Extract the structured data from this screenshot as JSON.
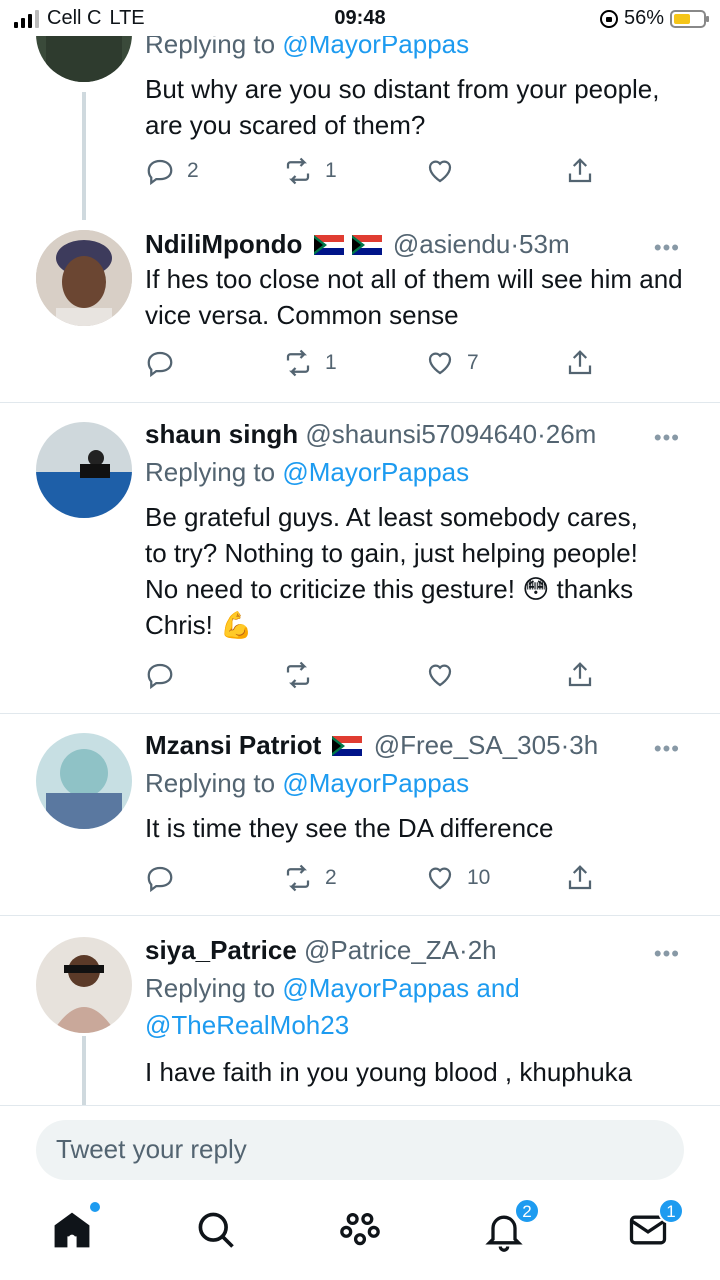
{
  "status_bar": {
    "carrier": "Cell C",
    "network": "LTE",
    "time": "09:48",
    "battery": "56%",
    "battery_level": 0.56
  },
  "tweets": [
    {
      "reply_label": "Replying to",
      "reply_mention": "@MayorPappas",
      "text": "But why are you so distant from your people, are you scared of them?",
      "replies": "2",
      "retweets": "1",
      "likes": ""
    },
    {
      "name": "NdiliMpondo",
      "handle": "@asiendu",
      "time": "53m",
      "text": "If hes too close not all of them will see him and vice versa. Common sense",
      "replies": "",
      "retweets": "1",
      "likes": "7"
    },
    {
      "name": "shaun singh",
      "handle": "@shaunsi57094640",
      "time": "26m",
      "reply_label": "Replying to",
      "reply_mention": "@MayorPappas",
      "text_line1": "Be grateful guys. At least somebody cares,",
      "text_line2": "to try? Nothing to gain, just helping people!",
      "text_line3_a": "No need to criticize this gesture!",
      "text_line3_emoji": "😳",
      "text_line3_b": "thanks",
      "text_line4": "Chris!",
      "text_line4_emoji": "💪",
      "replies": "",
      "retweets": "",
      "likes": ""
    },
    {
      "name": "Mzansi Patriot",
      "handle": "@Free_SA_305",
      "time": "3h",
      "reply_label": "Replying to",
      "reply_mention": "@MayorPappas",
      "text": "It is time they see the DA difference",
      "replies": "",
      "retweets": "2",
      "likes": "10"
    },
    {
      "name": "siya_Patrice",
      "handle": "@Patrice_ZA",
      "time": "2h",
      "reply_label": "Replying to",
      "reply_mention": "@MayorPappas",
      "reply_and": "and",
      "reply_mention2": "@TheRealMoh23",
      "text": "I have faith in you young blood , khuphuka"
    }
  ],
  "separator": "·",
  "more": "•••",
  "reply_box": {
    "placeholder": "Tweet your reply"
  },
  "nav": {
    "notifications_badge": "2",
    "messages_badge": "1"
  },
  "colors": {
    "accent": "#1d9bf0",
    "muted": "#536471"
  }
}
